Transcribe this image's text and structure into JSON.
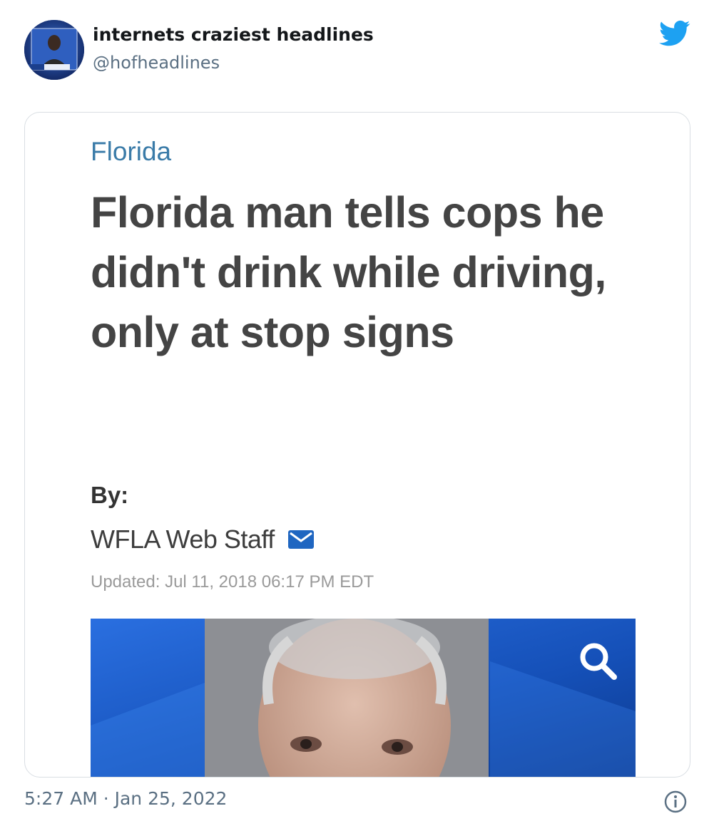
{
  "tweet": {
    "display_name": "internets craziest headlines",
    "handle": "@hofheadlines",
    "timestamp": "5:27 AM · Jan 25, 2022",
    "icons": {
      "brand": "twitter-bird-icon",
      "info": "info-icon"
    },
    "colors": {
      "twitter_blue": "#1da1f2",
      "secondary_text": "#5b7083"
    }
  },
  "article": {
    "section": "Florida",
    "headline": "Florida man tells cops he didn't drink while driving, only at stop signs",
    "by_label": "By:",
    "author": "WFLA Web Staff",
    "updated": "Updated: Jul 11, 2018 06:17 PM EDT",
    "icons": {
      "email": "email-icon",
      "search": "search-icon"
    },
    "colors": {
      "section": "#3a7ba8",
      "headline": "#444444",
      "photo_background": "#1a4fb0"
    }
  }
}
